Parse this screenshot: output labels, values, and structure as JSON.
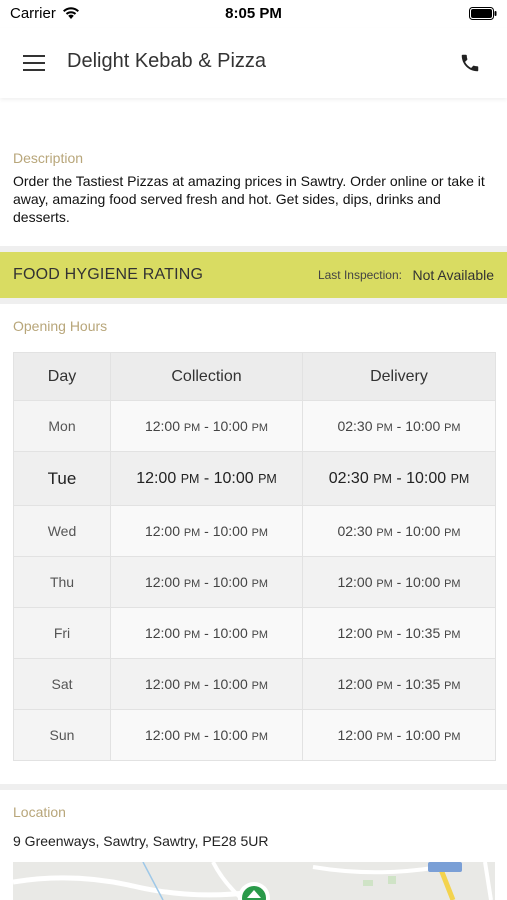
{
  "status_bar": {
    "carrier": "Carrier",
    "time": "8:05 PM"
  },
  "header": {
    "title": "Delight Kebab & Pizza",
    "menu_icon": "hamburger-menu-icon",
    "call_icon": "phone-icon"
  },
  "description": {
    "label": "Description",
    "text": "Order the Tastiest Pizzas at amazing prices in Sawtry. Order online or take it away, amazing food served fresh and hot. Get sides, dips, drinks and desserts."
  },
  "hygiene": {
    "label": "FOOD HYGIENE RATING",
    "last_inspection_label": "Last Inspection:",
    "last_inspection_value": "Not Available",
    "color": "#d9dc62"
  },
  "opening_hours": {
    "label": "Opening Hours",
    "columns": [
      "Day",
      "Collection",
      "Delivery"
    ],
    "rows": [
      {
        "day": "Mon",
        "collection": [
          "12:00",
          "PM",
          "10:00",
          "PM"
        ],
        "delivery": [
          "02:30",
          "PM",
          "10:00",
          "PM"
        ]
      },
      {
        "day": "Tue",
        "collection": [
          "12:00",
          "PM",
          "10:00",
          "PM"
        ],
        "delivery": [
          "02:30",
          "PM",
          "10:00",
          "PM"
        ]
      },
      {
        "day": "Wed",
        "collection": [
          "12:00",
          "PM",
          "10:00",
          "PM"
        ],
        "delivery": [
          "02:30",
          "PM",
          "10:00",
          "PM"
        ]
      },
      {
        "day": "Thu",
        "collection": [
          "12:00",
          "PM",
          "10:00",
          "PM"
        ],
        "delivery": [
          "12:00",
          "PM",
          "10:00",
          "PM"
        ]
      },
      {
        "day": "Fri",
        "collection": [
          "12:00",
          "PM",
          "10:00",
          "PM"
        ],
        "delivery": [
          "12:00",
          "PM",
          "10:35",
          "PM"
        ]
      },
      {
        "day": "Sat",
        "collection": [
          "12:00",
          "PM",
          "10:00",
          "PM"
        ],
        "delivery": [
          "12:00",
          "PM",
          "10:35",
          "PM"
        ]
      },
      {
        "day": "Sun",
        "collection": [
          "12:00",
          "PM",
          "10:00",
          "PM"
        ],
        "delivery": [
          "12:00",
          "PM",
          "10:00",
          "PM"
        ]
      }
    ],
    "highlighted_day": "Tue"
  },
  "location": {
    "label": "Location",
    "address": "9 Greenways, Sawtry, Sawtry, PE28 5UR",
    "map_marker_icon": "map-pin-icon"
  },
  "colors": {
    "label_gold": "#b8a67a",
    "separator": "#efefef"
  }
}
